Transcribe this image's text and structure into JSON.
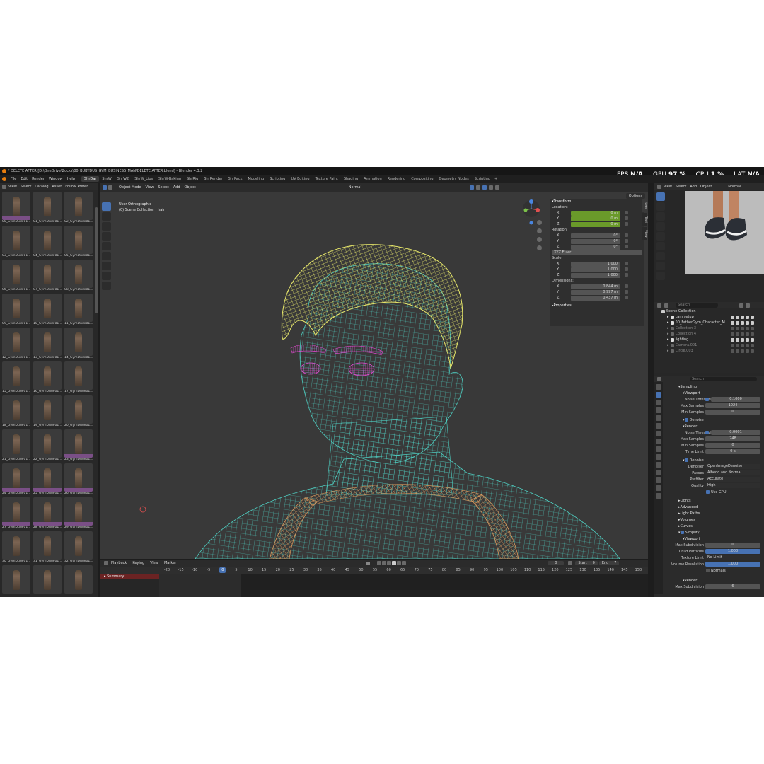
{
  "titlebar": {
    "title": "* DELETE AFTER [D:\\OneDrive\\Zucks\\00_BUBYDUS_GYM_BUSINESS_MAN\\DELETE AFTER.blend] - Blender 4.3.2"
  },
  "perf": {
    "fps_label": "FPS",
    "fps_value": "N/A",
    "gpu_label": "GPU",
    "gpu_value": "97 %",
    "cpu_label": "CPU",
    "cpu_value": "1 %",
    "lat_label": "LAT",
    "lat_value": "N/A"
  },
  "menu": [
    "File",
    "Edit",
    "Render",
    "Window",
    "Help"
  ],
  "workspaces": [
    "ShrDar",
    "ShrW",
    "ShrW2",
    "ShrW_Lips",
    "ShrW-Baking",
    "ShrRig",
    "ShrRender",
    "ShrPack",
    "Modeling",
    "Scripting",
    "UV Editing",
    "Texture Paint",
    "Shading",
    "Animation",
    "Rendering",
    "Compositing",
    "Geometry Nodes",
    "Scripting"
  ],
  "asset_browser": {
    "header": [
      "View",
      "Select",
      "Catalog",
      "Asset",
      "Follow Prefer"
    ],
    "items": [
      "00_GymDude01...",
      "01_GymDude01...",
      "02_GymDude01...",
      "03_GymDude01...",
      "04_GymDude01...",
      "05_GymDude01...",
      "06_GymDude01...",
      "07_GymDude01...",
      "08_GymDude01...",
      "09_GymDude01...",
      "10_GymDude01...",
      "11_GymDude01...",
      "12_GymDude01...",
      "13_GymDude01...",
      "14_GymDude01...",
      "15_GymDude01...",
      "16_GymDude01...",
      "17_GymDude01...",
      "18_GymDude01...",
      "19_GymDude01...",
      "20_GymDude01...",
      "21_GymDude01...",
      "22_GymDude01...",
      "23_GymDude01...",
      "24_GymDude01...",
      "25_GymDude01...",
      "26_GymDude01...",
      "27_GymDude01...",
      "28_GymDude01...",
      "29_GymDude01...",
      "30_GymDude01...",
      "31_GymDude01...",
      "32_GymDude01...",
      "",
      "",
      ""
    ],
    "lying_items": [
      0,
      23,
      24,
      25,
      26,
      27,
      28,
      29
    ]
  },
  "viewport": {
    "header": [
      "Object Mode",
      "View",
      "Select",
      "Add",
      "Object"
    ],
    "shading": "Normal",
    "options": "Options",
    "info_line1": "User Orthographic",
    "info_line2": "(0) Scene Collection | hair",
    "colors": {
      "skin_wire": "#4fd1c4",
      "hair_wire": "#e6e66a",
      "strap_wire": "#d99a5e",
      "eye_wire": "#e04ad0",
      "bg": "#393939"
    }
  },
  "npanel": {
    "title": "Transform",
    "location_label": "Location:",
    "location": [
      {
        "axis": "X",
        "value": "0 m"
      },
      {
        "axis": "Y",
        "value": "0 m"
      },
      {
        "axis": "Z",
        "value": "0 m"
      }
    ],
    "rotation_label": "Rotation:",
    "rotation": [
      {
        "axis": "X",
        "value": "0°"
      },
      {
        "axis": "Y",
        "value": "0°"
      },
      {
        "axis": "Z",
        "value": "0°"
      }
    ],
    "rotation_mode": "XYZ Euler",
    "scale_label": "Scale:",
    "scale": [
      {
        "axis": "X",
        "value": "1.000"
      },
      {
        "axis": "Y",
        "value": "1.000"
      },
      {
        "axis": "Z",
        "value": "1.000"
      }
    ],
    "dimensions_label": "Dimensions:",
    "dimensions": [
      {
        "axis": "X",
        "value": "0.844 m"
      },
      {
        "axis": "Y",
        "value": "0.997 m"
      },
      {
        "axis": "Z",
        "value": "0.437 m"
      }
    ],
    "properties": "Properties",
    "tabs": [
      "Item",
      "Tool",
      "View"
    ]
  },
  "timeline": {
    "header": [
      "Playback",
      "Keying",
      "View",
      "Marker"
    ],
    "current_frame": "0",
    "start_label": "Start",
    "start": "0",
    "end_label": "End",
    "end": "7",
    "ticks": [
      "-20",
      "-15",
      "-10",
      "-5",
      "0",
      "5",
      "10",
      "15",
      "20",
      "25",
      "30",
      "35",
      "40",
      "45",
      "50",
      "55",
      "60",
      "65",
      "70",
      "75",
      "80",
      "85",
      "90",
      "95",
      "100",
      "105",
      "110",
      "115",
      "120",
      "125",
      "130",
      "135",
      "140",
      "145",
      "150"
    ],
    "summary": "Summary"
  },
  "right_header": [
    "View",
    "Select",
    "Add",
    "Object"
  ],
  "right_shading": "Normal",
  "outliner": {
    "search_placeholder": "Search",
    "root": "Scene Collection",
    "items": [
      {
        "name": "cam setup",
        "dim": false
      },
      {
        "name": "00_FatherGym_Character_Main",
        "dim": false
      },
      {
        "name": "Collection 3",
        "dim": true
      },
      {
        "name": "Collection 4",
        "dim": true
      },
      {
        "name": "lighting",
        "dim": false
      },
      {
        "name": "Camera.001",
        "dim": true
      },
      {
        "name": "Circle.003",
        "dim": true
      }
    ]
  },
  "properties": {
    "search_placeholder": "Search",
    "sampling": "Sampling",
    "viewport": "Viewport",
    "noise_threshold_label": "Noise Threshold",
    "vp_noise_threshold": "0.1000",
    "max_samples_label": "Max Samples",
    "vp_max_samples": "1024",
    "min_samples_label": "Min Samples",
    "vp_min_samples": "0",
    "denoise": "Denoise",
    "render": "Render",
    "r_noise_threshold": "0.0001",
    "r_max_samples": "248",
    "r_min_samples": "0",
    "time_limit_label": "Time Limit",
    "time_limit": "0 s",
    "denoiser_label": "Denoiser",
    "denoiser": "OpenImageDenoise",
    "passes_label": "Passes",
    "passes": "Albedo and Normal",
    "prefilter_label": "Prefilter",
    "prefilter": "Accurate",
    "quality_label": "Quality",
    "quality": "High",
    "use_gpu": "Use GPU",
    "lights": "Lights",
    "advanced": "Advanced",
    "light_paths": "Light Paths",
    "volumes": "Volumes",
    "curves": "Curves",
    "simplify": "Simplify",
    "max_subdivision_label": "Max Subdivision",
    "s_max_subdivision": "0",
    "child_particles_label": "Child Particles",
    "child_particles": "1.000",
    "texture_limit_label": "Texture Limit",
    "texture_limit": "No Limit",
    "volume_resolution_label": "Volume Resolution",
    "volume_resolution": "1.000",
    "normals": "Normals",
    "render_section": "Render",
    "r_max_subdivision": "6"
  }
}
